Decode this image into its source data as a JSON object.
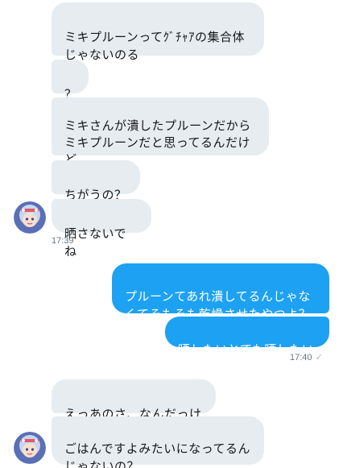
{
  "messages": [
    {
      "id": "m1",
      "side": "incoming",
      "text": "ミキプルーンってｸﾞﾁｬｱの集合体\nじゃないのる"
    },
    {
      "id": "m2",
      "side": "incoming",
      "text": "？"
    },
    {
      "id": "m3",
      "side": "incoming",
      "text": "ミキさんが潰したプルーンだから\nミキプルーンだと思ってるんだけ\nど"
    },
    {
      "id": "m4",
      "side": "incoming",
      "text": "ちがうの？"
    },
    {
      "id": "m5",
      "side": "incoming",
      "text": "晒さないでね"
    },
    {
      "id": "m6",
      "side": "outgoing",
      "text": "プルーンてあれ潰してるんじゃな\nくてそもそも乾燥させたやつよ？"
    },
    {
      "id": "m7",
      "side": "outgoing",
      "text": "晒したいとても晒したい"
    },
    {
      "id": "m8",
      "side": "incoming",
      "text": "えっあのさ、なんだっけ"
    },
    {
      "id": "m9",
      "side": "incoming",
      "text": "ごはんですよみたいになってるん\nじゃないの？"
    }
  ],
  "timestamps": {
    "incoming_group_1": "17:39",
    "outgoing_group_1": "17:40",
    "read_mark": "✓"
  },
  "avatar": {
    "icon": "user-avatar-icon",
    "colors": {
      "hair": "#c9d6f2",
      "skin": "#f7e0cf",
      "bg": "#5a6fb5",
      "accent": "#e05a6b"
    }
  },
  "colors": {
    "incoming_bubble": "#e6ecf0",
    "outgoing_bubble": "#1da1f2",
    "timestamp": "#657786"
  }
}
